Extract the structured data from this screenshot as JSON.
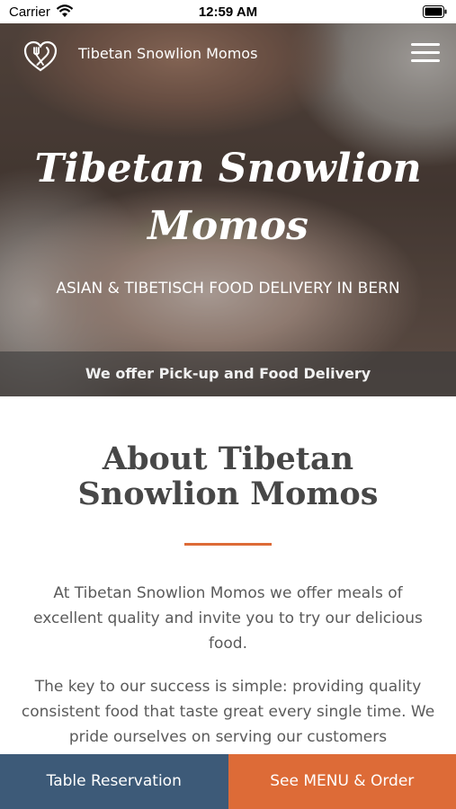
{
  "status_bar": {
    "carrier": "Carrier",
    "time": "12:59 AM",
    "icons": [
      "wifi-icon",
      "battery-icon"
    ]
  },
  "header": {
    "brand_name": "Tibetan Snowlion Momos",
    "logo_icon": "fork-knife-heart-icon",
    "menu_icon": "hamburger-menu-icon"
  },
  "hero": {
    "title": "Tibetan Snowlion Momos",
    "subtitle": "ASIAN & TIBETISCH FOOD DELIVERY IN BERN",
    "band_text": "We offer Pick-up and Food Delivery"
  },
  "about": {
    "title": "About Tibetan Snowlion Momos",
    "paragraph_1": "At Tibetan Snowlion Momos we offer meals of excellent quality and invite you to try our delicious food.",
    "paragraph_2": "The key to our success is simple: providing quality consistent food that taste great every single time. We pride ourselves on serving our customers"
  },
  "actions": {
    "reservation_label": "Table Reservation",
    "order_label": "See MENU & Order"
  },
  "colors": {
    "accent_orange": "#dd6b37",
    "navy_button": "#3d5a78",
    "heading_gray": "#474747"
  }
}
